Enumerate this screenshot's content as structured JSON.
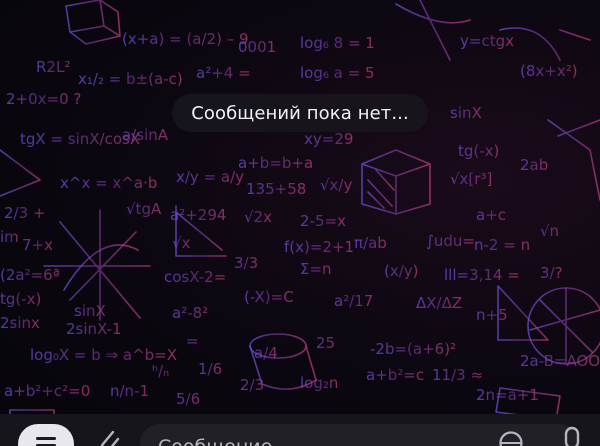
{
  "chat": {
    "empty_message": "Сообщений пока нет..."
  },
  "composer": {
    "placeholder": "Сообщение"
  },
  "icons": {
    "menu": "menu-icon",
    "attach": "paperclip-icon",
    "emoji": "emoji-icon",
    "mic": "microphone-icon"
  },
  "colors": {
    "background": "#08060d",
    "pill": "#18161e",
    "pill_text": "#f3f1f6",
    "doodle_left": "#6a4fd6",
    "doodle_right": "#c2407a"
  }
}
